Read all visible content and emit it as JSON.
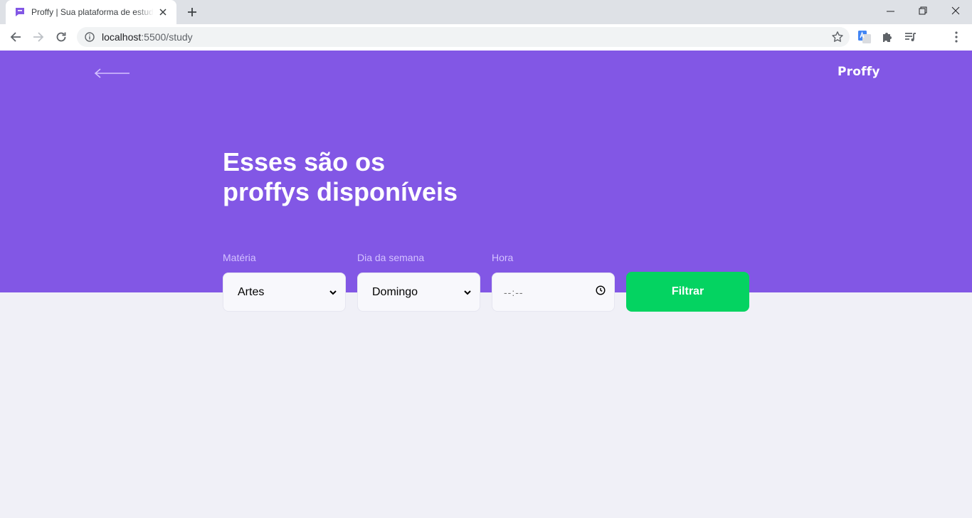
{
  "browser": {
    "tab_title": "Proffy | Sua plataforma de estudos",
    "url_host": "localhost",
    "url_rest": ":5500/study"
  },
  "header": {
    "logo_text": "Proffy"
  },
  "hero": {
    "headline_line1": "Esses são os",
    "headline_line2": "proffys disponíveis"
  },
  "filters": {
    "subject_label": "Matéria",
    "subject_value": "Artes",
    "weekday_label": "Dia da semana",
    "weekday_value": "Domingo",
    "time_label": "Hora",
    "time_value": "--:--",
    "submit_label": "Filtrar"
  },
  "colors": {
    "primary": "#8257E5",
    "secondary": "#04D361",
    "background": "#F0F0F7",
    "label": "#D4C2FF"
  },
  "icons": [
    "proffy-favicon-icon",
    "close-icon",
    "plus-icon",
    "minimize-icon",
    "restore-icon",
    "close-window-icon",
    "back-icon",
    "forward-icon",
    "reload-icon",
    "info-icon",
    "star-icon",
    "translate-icon",
    "puzzle-icon",
    "media-icon",
    "menu-icon",
    "arrow-left-icon",
    "chevron-down-icon",
    "clock-icon"
  ]
}
